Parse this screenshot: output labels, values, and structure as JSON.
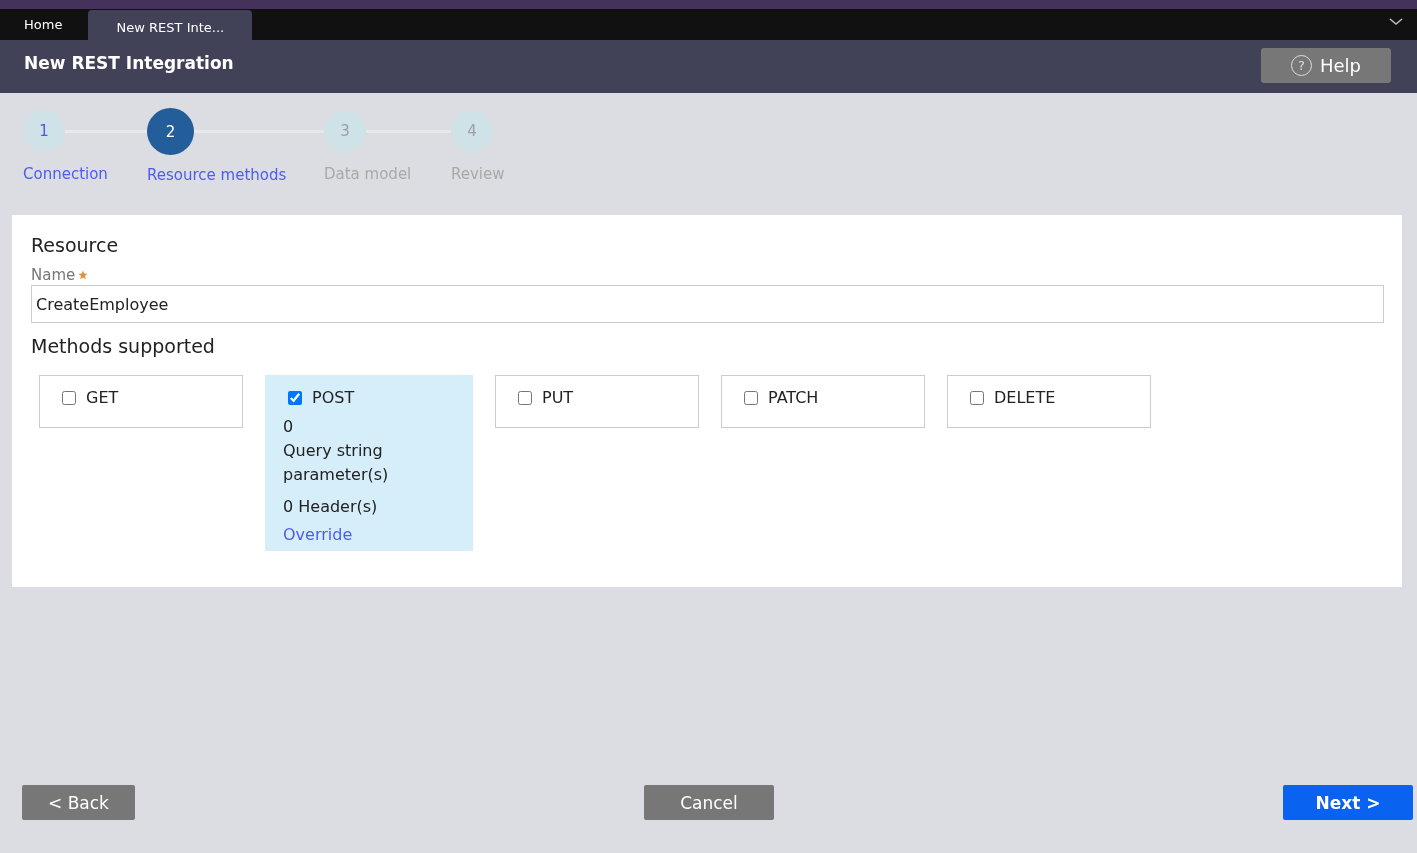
{
  "tabs": [
    {
      "label": "Home",
      "selected": false
    },
    {
      "label": "New REST Inte...",
      "selected": true
    }
  ],
  "header": {
    "title": "New REST Integration",
    "help_icon": "?",
    "help_button": "Help"
  },
  "steps": [
    {
      "number": "1",
      "label": "Connection",
      "done": true,
      "selected": false
    },
    {
      "number": "2",
      "label": "Resource methods",
      "done": false,
      "selected": true
    },
    {
      "number": "3",
      "label": "Data model",
      "done": false,
      "selected": false
    },
    {
      "number": "4",
      "label": "Review",
      "done": false,
      "selected": false
    }
  ],
  "resource": {
    "heading": "Resource",
    "name_label": "Name",
    "name_required": true,
    "name_value": "CreateEmployee"
  },
  "methods_heading": "Methods supported",
  "methods": [
    {
      "label": "GET",
      "checked": false
    },
    {
      "label": "POST",
      "checked": true,
      "query_count": "0",
      "query_label": "Query string parameter(s)",
      "headers": "0 Header(s)",
      "link": "Override"
    },
    {
      "label": "PUT",
      "checked": false
    },
    {
      "label": "PATCH",
      "checked": false
    },
    {
      "label": "DELETE",
      "checked": false
    }
  ],
  "footer": {
    "back": "< Back",
    "cancel": "Cancel",
    "next": "Next >"
  }
}
